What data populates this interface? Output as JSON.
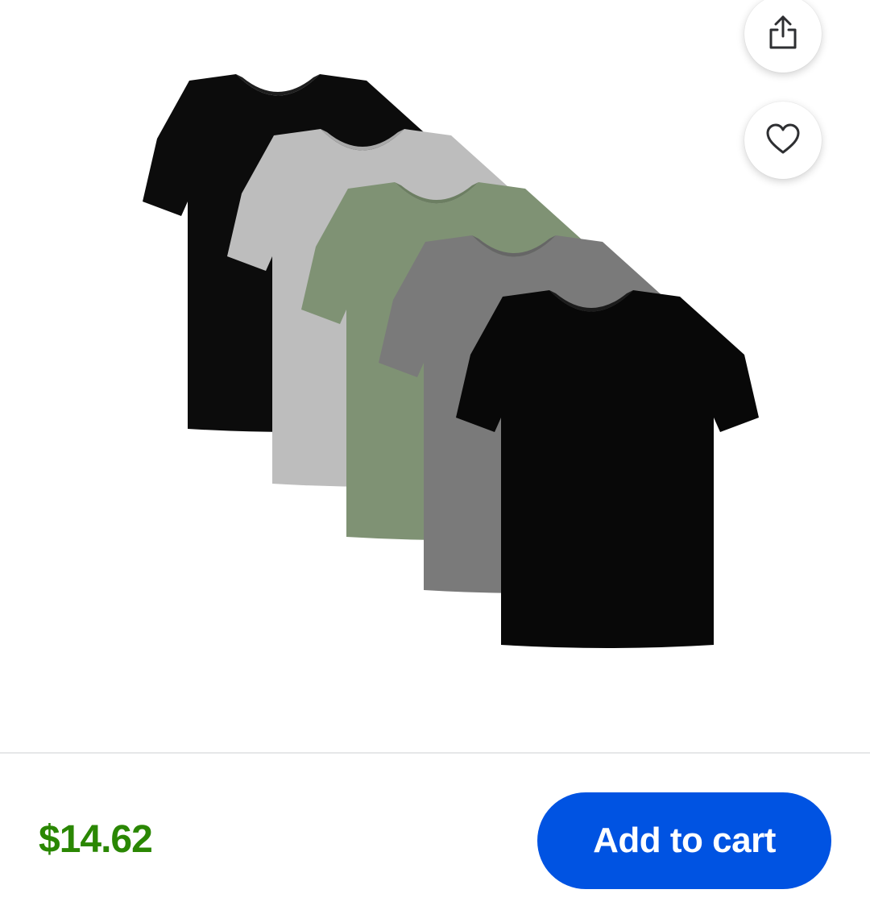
{
  "product": {
    "image_alt": "5-pack men's V-neck t-shirts: black, heather gray, olive green, charcoal, black",
    "shirt_colors": [
      "#0c0c0c",
      "#bdbdbd",
      "#7f9274",
      "#7a7a7a",
      "#080808"
    ]
  },
  "actions": {
    "share_icon": "share-icon",
    "favorite_icon": "heart-icon"
  },
  "purchase": {
    "price": "$14.62",
    "add_to_cart_label": "Add to cart",
    "price_color": "#2a8703",
    "button_color": "#0053e2"
  }
}
